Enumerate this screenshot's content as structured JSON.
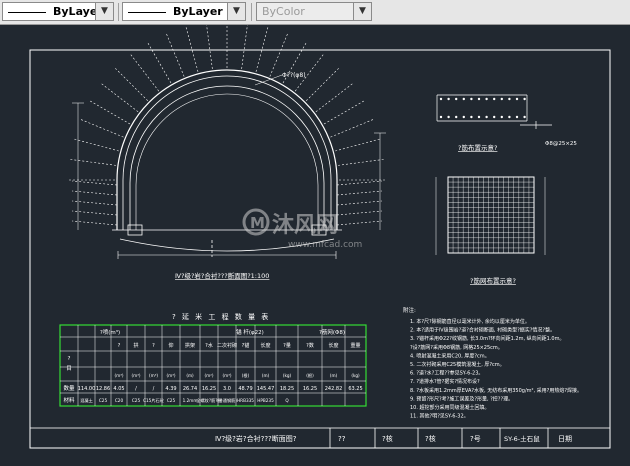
{
  "toolbar": {
    "linetype": {
      "value": "ByLayer"
    },
    "lineweight": {
      "value": "ByLayer"
    },
    "plotstyle": {
      "value": "ByColor"
    }
  },
  "drawing": {
    "section_title": "Ⅳ?级?岩?合衬???断面图?1:100",
    "dim_top": "Φ??(φ8)",
    "scale_small": "1:??",
    "detail1_title": "?筋布置示意?",
    "detail1_note": "Φ8@25×25",
    "detail2_title": "?筋网布置示意?",
    "table_title": "? 延 米 工 程 数 量 表",
    "notes_header": "附注:",
    "notes": [
      "1. 本?尺?除钢筋直径以毫米计外, 余均以厘米为单位。",
      "2. 本?适用于Ⅳ级围岩?道?合衬砌断面, 衬砌类型?据实?情况?整。",
      "3. ?锚杆采用Φ22?纹钢筋, 长3.0m?环向间距1.2m, 纵向间距1.0m。",
      "   ?设?筋网?采用Φ8钢筋, 网格25×25cm。",
      "4. 喷射混凝土采用C20, 厚度?cm。",
      "5. 二次衬砌采用C25模筑混凝土, 厚?cm。",
      "6. ?道?水?工程??参见SY-6-23。",
      "7. ?道排水?管?据实?情况布设?",
      "8. ?水板采用1.2mm厚EVA?水板, 无纺布采用350g/m², 采用?用热熔?焊接。",
      "9. 预留?形尺?考?施工误差及?形量, ?控??理。",
      "10. 超挖部分采用同级混凝土回填。",
      "11. 其他?明?见SY-6-32。"
    ],
    "title_block": {
      "name": "Ⅳ?级?岩?合衬???断面图?",
      "cells": [
        "??",
        "?核",
        "?核",
        "?号",
        "SY-6-土石鼠",
        "日期"
      ]
    },
    "table": {
      "row_labels": [
        "?",
        "目"
      ],
      "header_a": "?喷(m³)",
      "header_b": "锚 杆(φ22)",
      "header_c": "?筋网(Φ8)",
      "subheaders": [
        "?",
        "拱",
        "?",
        "仰",
        "拱架",
        "?水",
        "二次衬砌",
        "?锚",
        "长度",
        "?量",
        "?数",
        "长度",
        "重量"
      ],
      "unit_row": [
        "(m³)",
        "(m³)",
        "(m³)",
        "(m³)",
        "(m)",
        "(m²)",
        "(m³)",
        "(根)",
        "(m)",
        "(kg)",
        "(根)",
        "(m)",
        "(kg)"
      ],
      "data_row_label": "数量",
      "data_row": [
        "114.00",
        "12.86",
        "4.05",
        "/",
        "/",
        "4.39",
        "26.74",
        "16.25",
        "3.0",
        "48.79",
        "145.47",
        "18.25",
        "16.25",
        "242.82",
        "63.25"
      ],
      "material_row_label": "材料",
      "material_row": [
        "混凝土",
        "C25",
        "C20",
        "C25",
        "C15片石砼",
        "C25",
        "1.2mm",
        "全螺纹?筋?杆",
        "(普通钢筋)",
        "HRB335",
        "HPB235",
        "Q"
      ]
    }
  },
  "watermark": {
    "brand": "沐风网",
    "url": "www.mfcad.com"
  },
  "colors": {
    "background": "#212830",
    "lines": "#ffffff",
    "table_border": "#33dd33",
    "toolbar": "#e6e6e6"
  }
}
